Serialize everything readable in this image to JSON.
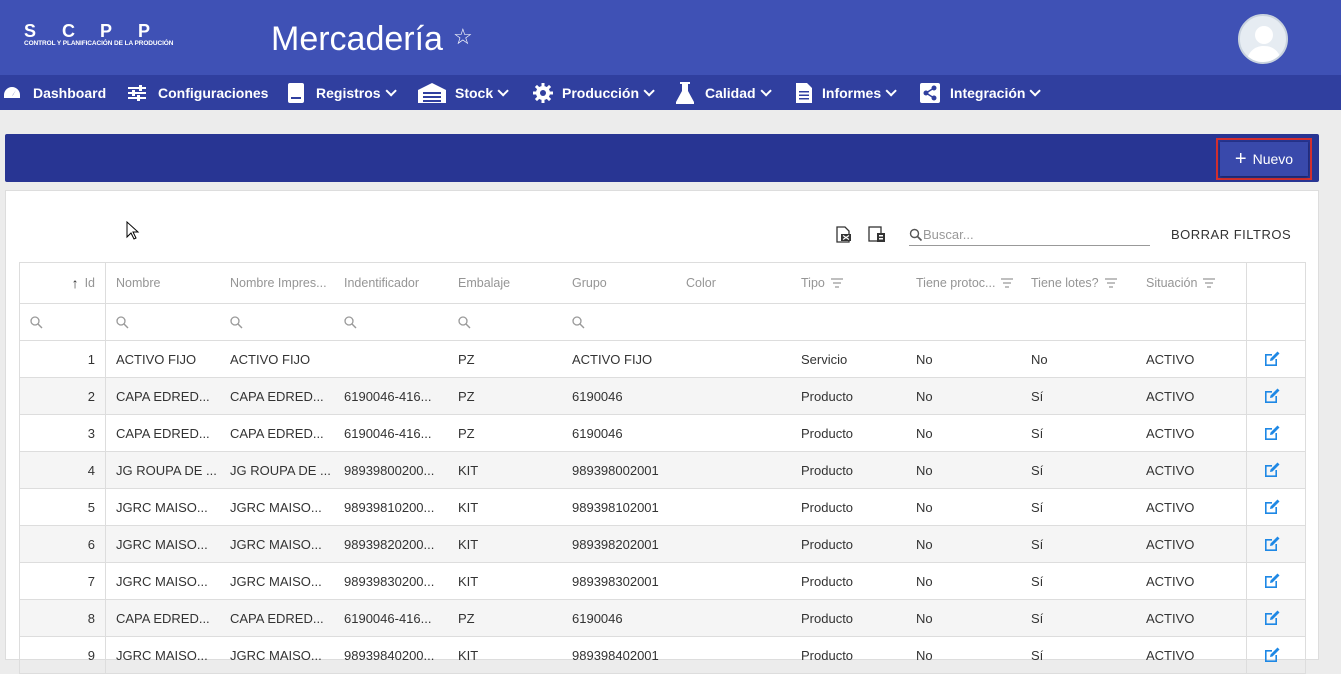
{
  "app": {
    "logo_letters": [
      "S",
      "C",
      "P",
      "P"
    ],
    "logo_subtitle": "CONTROL Y PLANIFICACIÓN DE LA PRODUCIÓN",
    "page_title": "Mercadería",
    "accent": "#3f51b5",
    "nav_color": "#303f9f",
    "band_color": "#283593"
  },
  "nav": [
    {
      "label": "Dashboard",
      "icon": "dashboard-icon"
    },
    {
      "label": "Configuraciones",
      "icon": "sliders-icon"
    },
    {
      "label": "Registros",
      "icon": "notebook-icon"
    },
    {
      "label": "Stock",
      "icon": "warehouse-icon"
    },
    {
      "label": "Producción",
      "icon": "gear-icon"
    },
    {
      "label": "Calidad",
      "icon": "flask-icon"
    },
    {
      "label": "Informes",
      "icon": "document-icon"
    },
    {
      "label": "Integración",
      "icon": "share-icon"
    }
  ],
  "toolbar": {
    "new_label": "Nuevo"
  },
  "search": {
    "placeholder": "Buscar..."
  },
  "clear_filters_label": "BORRAR FILTROS",
  "columns": [
    "Id",
    "Nombre",
    "Nombre Impres...",
    "Indentificador",
    "Embalaje",
    "Grupo",
    "Color",
    "Tipo",
    "Tiene protoc...",
    "Tiene lotes?",
    "Situación"
  ],
  "rows": [
    [
      "1",
      "ACTIVO FIJO",
      "ACTIVO FIJO",
      "",
      "PZ",
      "ACTIVO FIJO",
      "",
      "Servicio",
      "No",
      "No",
      "ACTIVO"
    ],
    [
      "2",
      "CAPA EDRED...",
      "CAPA EDRED...",
      "6190046-416...",
      "PZ",
      "6190046",
      "",
      "Producto",
      "No",
      "Sí",
      "ACTIVO"
    ],
    [
      "3",
      "CAPA EDRED...",
      "CAPA EDRED...",
      "6190046-416...",
      "PZ",
      "6190046",
      "",
      "Producto",
      "No",
      "Sí",
      "ACTIVO"
    ],
    [
      "4",
      "JG ROUPA DE ...",
      "JG ROUPA DE ...",
      "98939800200...",
      "KIT",
      "989398002001",
      "",
      "Producto",
      "No",
      "Sí",
      "ACTIVO"
    ],
    [
      "5",
      "JGRC MAISO...",
      "JGRC MAISO...",
      "98939810200...",
      "KIT",
      "989398102001",
      "",
      "Producto",
      "No",
      "Sí",
      "ACTIVO"
    ],
    [
      "6",
      "JGRC MAISO...",
      "JGRC MAISO...",
      "98939820200...",
      "KIT",
      "989398202001",
      "",
      "Producto",
      "No",
      "Sí",
      "ACTIVO"
    ],
    [
      "7",
      "JGRC MAISO...",
      "JGRC MAISO...",
      "98939830200...",
      "KIT",
      "989398302001",
      "",
      "Producto",
      "No",
      "Sí",
      "ACTIVO"
    ],
    [
      "8",
      "CAPA EDRED...",
      "CAPA EDRED...",
      "6190046-416...",
      "PZ",
      "6190046",
      "",
      "Producto",
      "No",
      "Sí",
      "ACTIVO"
    ],
    [
      "9",
      "JGRC MAISO...",
      "JGRC MAISO...",
      "98939840200...",
      "KIT",
      "989398402001",
      "",
      "Producto",
      "No",
      "Sí",
      "ACTIVO"
    ]
  ]
}
